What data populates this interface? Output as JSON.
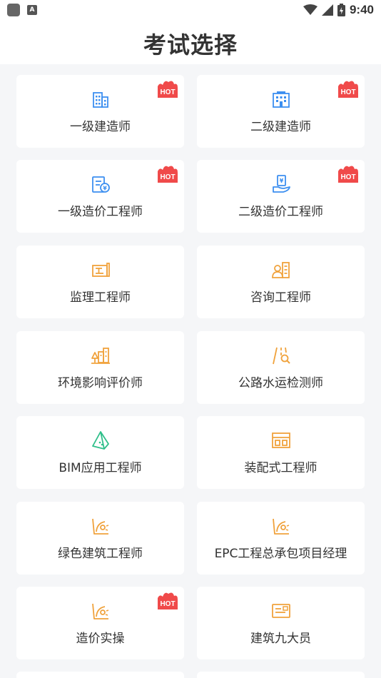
{
  "statusbar": {
    "time": "9:40",
    "a_icon_letter": "A"
  },
  "header": {
    "title": "考试选择"
  },
  "colors": {
    "blue": "#3c8ff0",
    "orange": "#f0a23c",
    "green": "#2fbf8a",
    "hot": "#f04a4a"
  },
  "hot_badge_text": "HOT",
  "exams": [
    {
      "label": "一级建造师",
      "icon": "office-building-icon",
      "hot": true
    },
    {
      "label": "二级建造师",
      "icon": "building-icon",
      "hot": true
    },
    {
      "label": "一级造价工程师",
      "icon": "cost-document-icon",
      "hot": true
    },
    {
      "label": "二级造价工程师",
      "icon": "hand-money-icon",
      "hot": true
    },
    {
      "label": "监理工程师",
      "icon": "blueprint-icon",
      "hot": false
    },
    {
      "label": "咨询工程师",
      "icon": "consultant-icon",
      "hot": false
    },
    {
      "label": "环境影响评价师",
      "icon": "environment-icon",
      "hot": false
    },
    {
      "label": "公路水运检测师",
      "icon": "road-inspect-icon",
      "hot": false
    },
    {
      "label": "BIM应用工程师",
      "icon": "bim-pyramid-icon",
      "hot": false
    },
    {
      "label": "装配式工程师",
      "icon": "prefab-window-icon",
      "hot": false
    },
    {
      "label": "绿色建筑工程师",
      "icon": "green-building-icon",
      "hot": false
    },
    {
      "label": "EPC工程总承包项目经理",
      "icon": "epc-icon",
      "hot": false
    },
    {
      "label": "造价实操",
      "icon": "practice-icon",
      "hot": true
    },
    {
      "label": "建筑九大员",
      "icon": "id-card-icon",
      "hot": false
    }
  ]
}
